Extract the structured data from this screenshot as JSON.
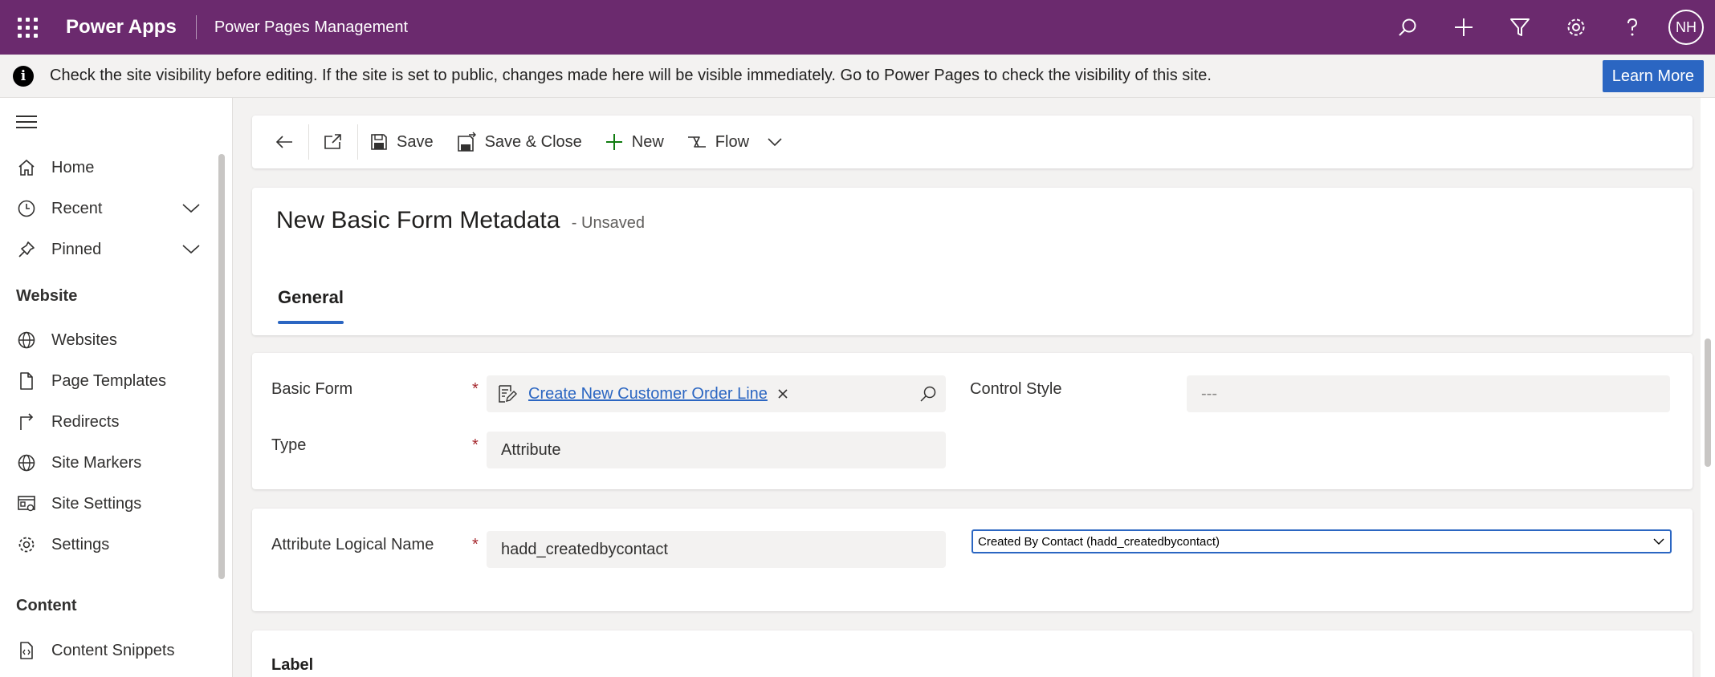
{
  "topbar": {
    "app_name": "Power Apps",
    "app_subtitle": "Power Pages Management",
    "avatar_initials": "NH",
    "bg_color": "#6b2a6e"
  },
  "notification": {
    "text": "Check the site visibility before editing. If the site is set to public, changes made here will be visible immediately. Go to Power Pages to check the visibility of this site.",
    "button_label": "Learn More"
  },
  "sidebar": {
    "items_top": [
      {
        "label": "Home",
        "icon": "home-icon"
      },
      {
        "label": "Recent",
        "icon": "clock-icon"
      },
      {
        "label": "Pinned",
        "icon": "pin-icon"
      }
    ],
    "section_website": "Website",
    "items_website": [
      {
        "label": "Websites",
        "icon": "globe-icon"
      },
      {
        "label": "Page Templates",
        "icon": "document-icon"
      },
      {
        "label": "Redirects",
        "icon": "redirect-icon"
      },
      {
        "label": "Site Markers",
        "icon": "globe-icon"
      },
      {
        "label": "Site Settings",
        "icon": "site-settings-icon"
      },
      {
        "label": "Settings",
        "icon": "gear-icon"
      }
    ],
    "section_content": "Content",
    "items_content": [
      {
        "label": "Content Snippets",
        "icon": "snippet-icon"
      }
    ]
  },
  "commandbar": {
    "save": "Save",
    "save_close": "Save & Close",
    "new": "New",
    "flow": "Flow"
  },
  "form": {
    "title": "New Basic Form Metadata",
    "status": "- Unsaved",
    "tab": "General",
    "basic_form_label": "Basic Form",
    "basic_form_value": "Create New Customer Order Line",
    "control_style_label": "Control Style",
    "control_style_value": "---",
    "type_label": "Type",
    "type_value": "Attribute",
    "attr_logical_name_label": "Attribute Logical Name",
    "attr_logical_name_value": "hadd_createdbycontact",
    "attr_select_value": "Created By Contact (hadd_createdbycontact)",
    "required_marker": "*",
    "label_section": "Label"
  }
}
